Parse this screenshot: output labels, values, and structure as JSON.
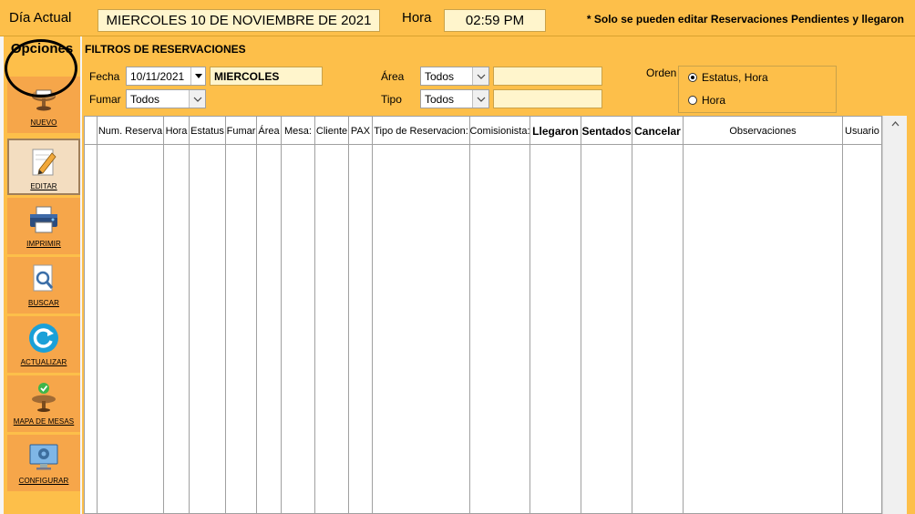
{
  "header": {
    "dia_actual_label": "Día Actual",
    "date_value": "MIERCOLES 10 DE NOVIEMBRE DE 2021",
    "hora_label": "Hora",
    "time_value": "02:59 PM",
    "note": "* Solo se pueden editar Reservaciones Pendientes y llegaron"
  },
  "sidebar": {
    "title": "Opciones",
    "items": [
      {
        "label": "NUEVO",
        "icon": "new-reservation-icon"
      },
      {
        "label": "EDITAR",
        "icon": "edit-pencil-icon"
      },
      {
        "label": "IMPRIMIR",
        "icon": "printer-icon"
      },
      {
        "label": "BUSCAR",
        "icon": "search-document-icon"
      },
      {
        "label": "ACTUALIZAR",
        "icon": "refresh-icon"
      },
      {
        "label": "MAPA DE MESAS",
        "icon": "table-map-icon"
      },
      {
        "label": "CONFIGURAR",
        "icon": "settings-monitor-icon"
      }
    ]
  },
  "filters": {
    "title": "FILTROS DE RESERVACIONES",
    "fecha_label": "Fecha",
    "fecha_value": "10/11/2021",
    "day_name": "MIERCOLES",
    "fumar_label": "Fumar",
    "fumar_value": "Todos",
    "area_label": "Área",
    "area_value": "Todos",
    "tipo_label": "Tipo",
    "tipo_value": "Todos",
    "orden_label": "Orden",
    "orden_options": [
      "Estatus, Hora",
      "Hora"
    ],
    "orden_selected": "Estatus, Hora"
  },
  "grid": {
    "columns": [
      {
        "label": "Num. Reserva",
        "bold": false
      },
      {
        "label": "Hora",
        "bold": false
      },
      {
        "label": "Estatus",
        "bold": false
      },
      {
        "label": "Fumar",
        "bold": false
      },
      {
        "label": "Área",
        "bold": false
      },
      {
        "label": "Mesa:",
        "bold": false
      },
      {
        "label": "Cliente",
        "bold": false
      },
      {
        "label": "PAX",
        "bold": false
      },
      {
        "label": "Tipo de Reservacion:",
        "bold": false
      },
      {
        "label": "Comisionista:",
        "bold": false
      },
      {
        "label": "Llegaron",
        "bold": true
      },
      {
        "label": "Sentados",
        "bold": true
      },
      {
        "label": "Cancelar",
        "bold": true
      },
      {
        "label": "Observaciones",
        "bold": false
      },
      {
        "label": "Usuario (",
        "bold": false
      }
    ],
    "rows": []
  },
  "colors": {
    "panel": "#fdbf4a",
    "button": "#f6a64a",
    "highlight_box": "#fff5cc"
  }
}
